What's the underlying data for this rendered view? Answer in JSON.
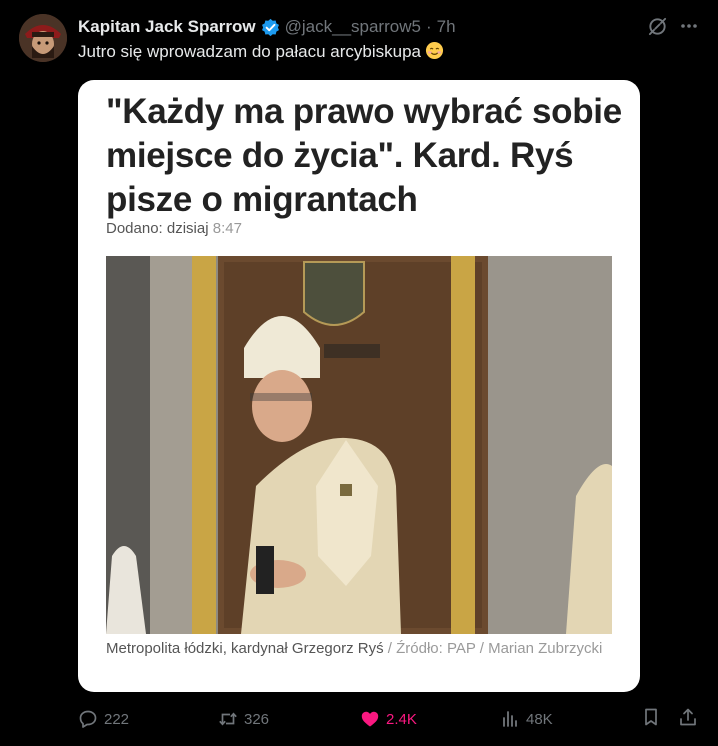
{
  "tweet": {
    "author": {
      "display_name": "Kapitan Jack Sparrow",
      "handle": "@jack__sparrow5",
      "separator": "·",
      "time": "7h",
      "avatar_icon": "pirate-avatar"
    },
    "text": "Jutro się wprowadzam do pałacu arcybiskupa",
    "emoji": "smiling-face-emoji"
  },
  "card": {
    "headline": "\"Każdy ma prawo wybrać sobie miejsce do życia\". Kard. Ryś pisze o migrantach",
    "date_label": "Dodano: dzisiaj",
    "date_time": "8:47",
    "caption_main": "Metropolita łódzki, kardynał Grzegorz Ryś",
    "caption_source": " / Źródło: PAP / Marian Zubrzycki"
  },
  "actions": {
    "replies": "222",
    "retweets": "326",
    "likes": "2.4K",
    "views": "48K"
  },
  "colors": {
    "background": "#000000",
    "text": "#e7e9ea",
    "muted": "#71767b",
    "verified": "#1d9bf0",
    "like": "#f91880"
  }
}
